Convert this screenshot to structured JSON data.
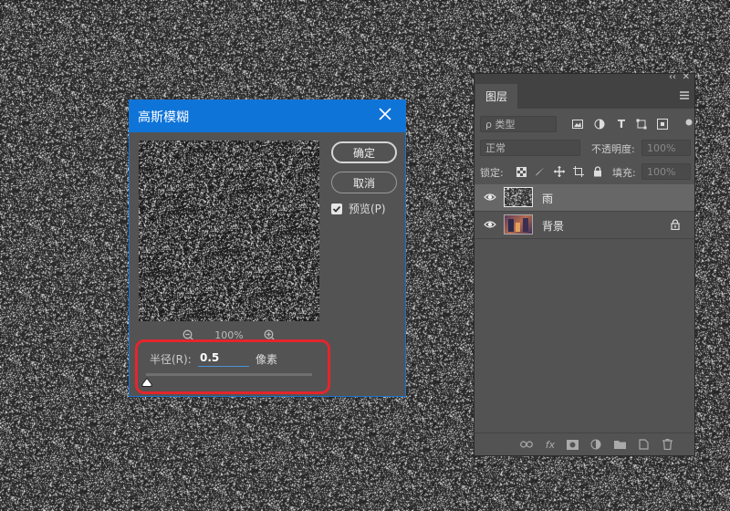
{
  "dialog": {
    "title": "高斯模糊",
    "ok_label": "确定",
    "cancel_label": "取消",
    "preview_label": "预览(P)",
    "preview_checked": true,
    "zoom_level": "100%",
    "radius_label": "半径(R):",
    "radius_value": "0.5",
    "radius_unit": "像素",
    "slider_fraction": 0.0
  },
  "layers_panel": {
    "tab_label": "图层",
    "filter_kind": "ρ 类型",
    "blend_mode": "正常",
    "opacity_label": "不透明度:",
    "opacity_value": "100%",
    "lock_label": "锁定:",
    "fill_label": "填充:",
    "fill_value": "100%",
    "layers": [
      {
        "name": "雨",
        "selected": true,
        "locked": false
      },
      {
        "name": "背景",
        "selected": false,
        "locked": true
      }
    ]
  },
  "colors": {
    "titlebar": "#0f74d8",
    "highlight": "#e3262c",
    "panel_bg": "#535353"
  },
  "icons": {
    "zoom_out": "zoom-out-icon",
    "zoom_in": "zoom-in-icon",
    "close": "close-icon",
    "eye": "eye-icon",
    "lock": "lock-icon"
  }
}
